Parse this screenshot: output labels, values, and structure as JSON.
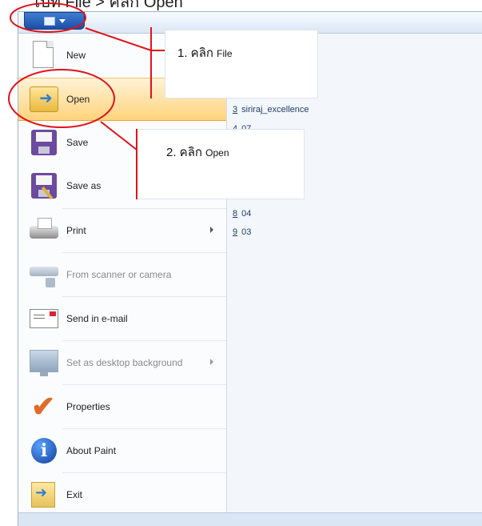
{
  "caption": {
    "text": "ไปที่ File > คลิก Open"
  },
  "menu": {
    "items": [
      {
        "label": "New",
        "icon": "new-document-icon"
      },
      {
        "label": "Open",
        "icon": "open-folder-icon"
      },
      {
        "label": "Save",
        "icon": "save-disk-icon"
      },
      {
        "label": "Save as",
        "icon": "save-as-icon"
      },
      {
        "label": "Print",
        "icon": "printer-icon"
      },
      {
        "label": "From scanner or camera",
        "icon": "scanner-icon"
      },
      {
        "label": "Send in e-mail",
        "icon": "email-icon"
      },
      {
        "label": "Set as desktop background",
        "icon": "desktop-background-icon"
      },
      {
        "label": "Properties",
        "icon": "properties-check-icon"
      },
      {
        "label": "About Paint",
        "icon": "info-icon"
      },
      {
        "label": "Exit",
        "icon": "exit-icon"
      }
    ]
  },
  "recent": {
    "items": [
      {
        "num": "3",
        "name": "siriraj_excellence"
      },
      {
        "num": "4",
        "name": "07"
      },
      {
        "num": "8",
        "name": "04"
      },
      {
        "num": "9",
        "name": "03"
      }
    ]
  },
  "callouts": {
    "step1": {
      "main": "1. คลิก",
      "small": "File"
    },
    "step2": {
      "main": "2. คลิก",
      "small": "Open"
    }
  },
  "colors": {
    "annotation": "#e0131a",
    "highlight": "#ffd37c",
    "app_button": "#1b4ea6"
  }
}
